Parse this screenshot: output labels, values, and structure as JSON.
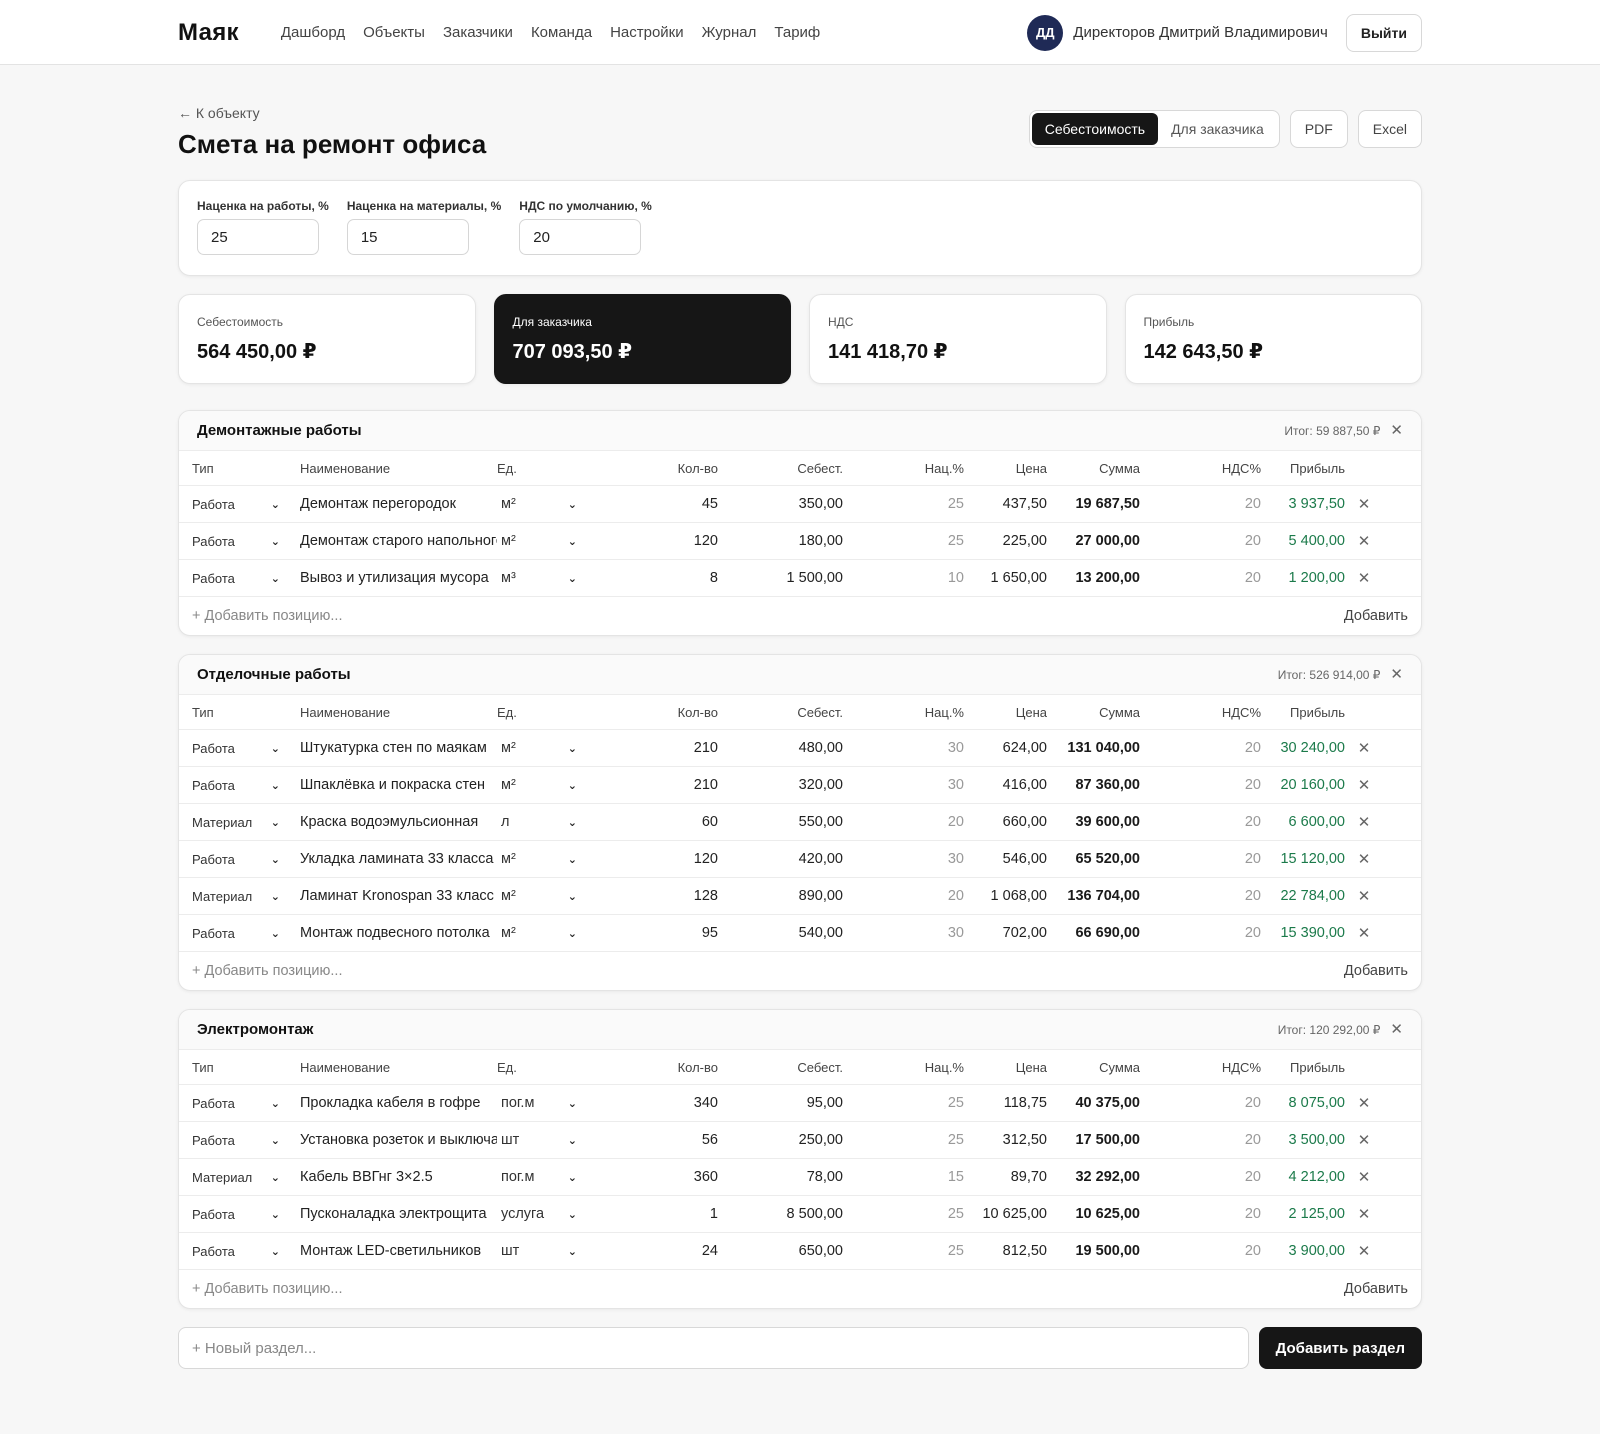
{
  "header": {
    "brand": "Маяк",
    "nav": [
      "Дашборд",
      "Объекты",
      "Заказчики",
      "Команда",
      "Настройки",
      "Журнал",
      "Тариф"
    ],
    "user_initials": "ДД",
    "user_name": "Директоров Дмитрий Владимирович",
    "logout": "Выйти"
  },
  "page": {
    "back": "← К объекту",
    "title": "Смета на ремонт офиса",
    "view_cost": "Себестоимость",
    "view_client": "Для заказчика",
    "pdf": "PDF",
    "excel": "Excel"
  },
  "settings": {
    "work_markup_label": "Наценка на работы, %",
    "work_markup": "25",
    "material_markup_label": "Наценка на материалы, %",
    "material_markup": "15",
    "vat_label": "НДС по умолчанию, %",
    "vat": "20"
  },
  "summary": [
    {
      "label": "Себестоимость",
      "value": "564 450,00 ₽"
    },
    {
      "label": "Для заказчика",
      "value": "707 093,50 ₽"
    },
    {
      "label": "НДС",
      "value": "141 418,70 ₽"
    },
    {
      "label": "Прибыль",
      "value": "142 643,50 ₽"
    }
  ],
  "columns": [
    "Тип",
    "Наименование",
    "Ед.",
    "Кол-во",
    "Себест.",
    "Нац.%",
    "Цена",
    "Сумма",
    "НДС%",
    "Прибыль"
  ],
  "add_placeholder": "+ Добавить позицию...",
  "add_label": "Добавить",
  "sections": [
    {
      "title": "Демонтажные работы",
      "total": "Итог: 59 887,50 ₽",
      "rows": [
        {
          "type": "Работа",
          "name": "Демонтаж перегородок",
          "unit": "м²",
          "qty": "45",
          "cost": "350,00",
          "markup": "25",
          "price": "437,50",
          "sum": "19 687,50",
          "vat": "20",
          "profit": "3 937,50"
        },
        {
          "type": "Работа",
          "name": "Демонтаж старого напольного покрытия",
          "unit": "м²",
          "qty": "120",
          "cost": "180,00",
          "markup": "25",
          "price": "225,00",
          "sum": "27 000,00",
          "vat": "20",
          "profit": "5 400,00"
        },
        {
          "type": "Работа",
          "name": "Вывоз и утилизация мусора",
          "unit": "м³",
          "qty": "8",
          "cost": "1 500,00",
          "markup": "10",
          "price": "1 650,00",
          "sum": "13 200,00",
          "vat": "20",
          "profit": "1 200,00"
        }
      ]
    },
    {
      "title": "Отделочные работы",
      "total": "Итог: 526 914,00 ₽",
      "rows": [
        {
          "type": "Работа",
          "name": "Штукатурка стен по маякам",
          "unit": "м²",
          "qty": "210",
          "cost": "480,00",
          "markup": "30",
          "price": "624,00",
          "sum": "131 040,00",
          "vat": "20",
          "profit": "30 240,00"
        },
        {
          "type": "Работа",
          "name": "Шпаклёвка и покраска стен",
          "unit": "м²",
          "qty": "210",
          "cost": "320,00",
          "markup": "30",
          "price": "416,00",
          "sum": "87 360,00",
          "vat": "20",
          "profit": "20 160,00"
        },
        {
          "type": "Материал",
          "name": "Краска водоэмульсионная",
          "unit": "л",
          "qty": "60",
          "cost": "550,00",
          "markup": "20",
          "price": "660,00",
          "sum": "39 600,00",
          "vat": "20",
          "profit": "6 600,00"
        },
        {
          "type": "Работа",
          "name": "Укладка ламината 33 класса",
          "unit": "м²",
          "qty": "120",
          "cost": "420,00",
          "markup": "30",
          "price": "546,00",
          "sum": "65 520,00",
          "vat": "20",
          "profit": "15 120,00"
        },
        {
          "type": "Материал",
          "name": "Ламинат Kronospan 33 класс",
          "unit": "м²",
          "qty": "128",
          "cost": "890,00",
          "markup": "20",
          "price": "1 068,00",
          "sum": "136 704,00",
          "vat": "20",
          "profit": "22 784,00"
        },
        {
          "type": "Работа",
          "name": "Монтаж подвесного потолка",
          "unit": "м²",
          "qty": "95",
          "cost": "540,00",
          "markup": "30",
          "price": "702,00",
          "sum": "66 690,00",
          "vat": "20",
          "profit": "15 390,00"
        }
      ]
    },
    {
      "title": "Электромонтаж",
      "total": "Итог: 120 292,00 ₽",
      "rows": [
        {
          "type": "Работа",
          "name": "Прокладка кабеля в гофре",
          "unit": "пог.м",
          "qty": "340",
          "cost": "95,00",
          "markup": "25",
          "price": "118,75",
          "sum": "40 375,00",
          "vat": "20",
          "profit": "8 075,00"
        },
        {
          "type": "Работа",
          "name": "Установка розеток и выключателей",
          "unit": "шт",
          "qty": "56",
          "cost": "250,00",
          "markup": "25",
          "price": "312,50",
          "sum": "17 500,00",
          "vat": "20",
          "profit": "3 500,00"
        },
        {
          "type": "Материал",
          "name": "Кабель ВВГнг 3×2.5",
          "unit": "пог.м",
          "qty": "360",
          "cost": "78,00",
          "markup": "15",
          "price": "89,70",
          "sum": "32 292,00",
          "vat": "20",
          "profit": "4 212,00"
        },
        {
          "type": "Работа",
          "name": "Пусконаладка электрощита",
          "unit": "услуга",
          "qty": "1",
          "cost": "8 500,00",
          "markup": "25",
          "price": "10 625,00",
          "sum": "10 625,00",
          "vat": "20",
          "profit": "2 125,00"
        },
        {
          "type": "Работа",
          "name": "Монтаж LED-светильников",
          "unit": "шт",
          "qty": "24",
          "cost": "650,00",
          "markup": "25",
          "price": "812,50",
          "sum": "19 500,00",
          "vat": "20",
          "profit": "3 900,00"
        }
      ]
    }
  ],
  "new_section": {
    "placeholder": "+ Новый раздел...",
    "button": "Добавить раздел"
  },
  "colors": {
    "accent_dark": "#161616",
    "profit_green": "#1b7a4a",
    "avatar_navy": "#1f2a56"
  },
  "icons": {
    "delete": "close-icon",
    "dropdown": "chevron-down-icon"
  }
}
